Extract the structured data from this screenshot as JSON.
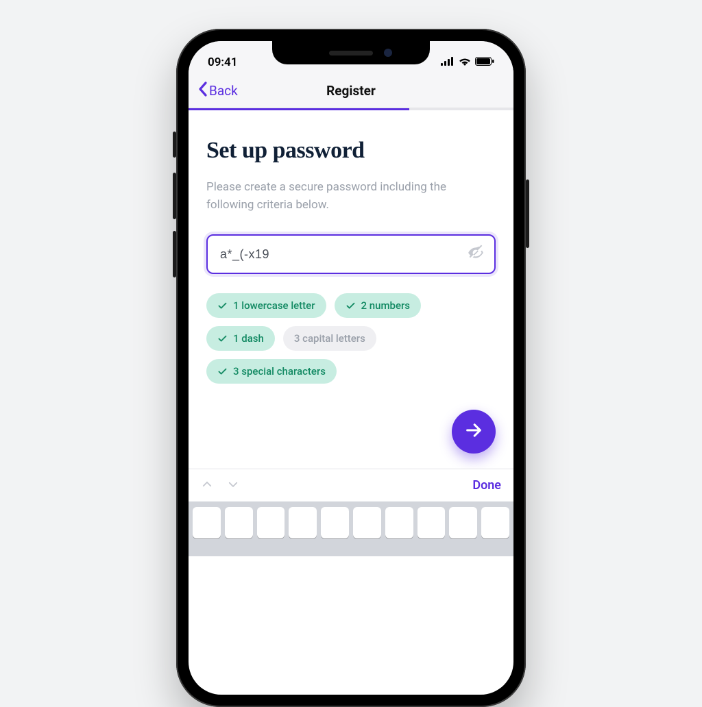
{
  "status": {
    "time": "09:41"
  },
  "nav": {
    "back_label": "Back",
    "title": "Register",
    "progress_pct": 68
  },
  "page": {
    "heading": "Set up password",
    "subtext": "Please create a secure password including the following criteria below."
  },
  "password": {
    "value": "a*_(-x19",
    "visibility_toggle_icon": "eye-off-icon"
  },
  "criteria": [
    {
      "label": "1 lowercase letter",
      "met": true
    },
    {
      "label": "2 numbers",
      "met": true
    },
    {
      "label": "1 dash",
      "met": true
    },
    {
      "label": "3 capital letters",
      "met": false
    },
    {
      "label": "3 special characters",
      "met": true
    }
  ],
  "keyboard": {
    "done_label": "Done"
  },
  "colors": {
    "accent": "#5b2ee0",
    "success_bg": "#c7ede1",
    "success_fg": "#138a63",
    "muted_bg": "#efeff2",
    "muted_fg": "#9aa0aa",
    "heading": "#102036"
  }
}
